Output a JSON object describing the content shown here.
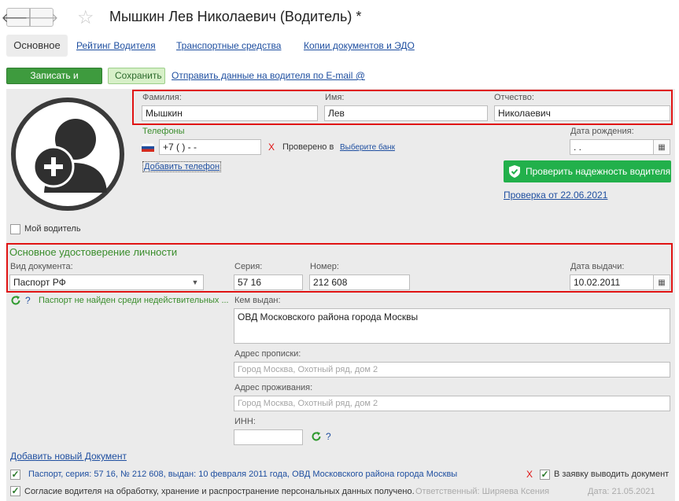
{
  "window": {
    "title": "Мышкин Лев Николаевич (Водитель) *",
    "back_icon": "arrow-left-icon",
    "forward_icon": "arrow-right-icon",
    "favorite_icon": "star-icon"
  },
  "tabs": [
    {
      "label": "Основное"
    },
    {
      "label": "Рейтинг Водителя"
    },
    {
      "label": "Транспортные средства"
    },
    {
      "label": "Копии документов и ЭДО"
    }
  ],
  "toolbar": {
    "save_close_label": "Записать и закрыть",
    "save_label": "Сохранить",
    "send_email_label": "Отправить данные на водителя по E-mail @"
  },
  "name": {
    "surname_label": "Фамилия:",
    "surname_value": "Мышкин",
    "firstname_label": "Имя:",
    "firstname_value": "Лев",
    "patronymic_label": "Отчество:",
    "patronymic_value": "Николаевич"
  },
  "phones": {
    "section_label": "Телефоны",
    "phone_value": "+7 (   )     -    -",
    "invalid_mark": "X",
    "verified_label": "Проверено в",
    "choose_bank_link": "Выберите банк",
    "add_phone_link": "Добавить телефон"
  },
  "birth": {
    "label": "Дата рождения:",
    "value": "  .  ."
  },
  "reliability": {
    "button_label": "Проверить надежность водителя",
    "check_link": "Проверка от 22.06.2021"
  },
  "my_driver": {
    "label": "Мой водитель",
    "checked": false
  },
  "identity": {
    "section_title": "Основное удостоверение личности",
    "doc_type_label": "Вид документа:",
    "doc_type_value": "Паспорт РФ",
    "series_label": "Серия:",
    "series_value": "57 16",
    "number_label": "Номер:",
    "number_value": "212 608",
    "issue_date_label": "Дата выдачи:",
    "issue_date_value": "10.02.2011",
    "invalid_check_question": "?",
    "invalid_check_text": "Паспорт не найден среди недействительных ...",
    "issued_by_label": "Кем выдан:",
    "issued_by_value": "ОВД Московского района города Москвы"
  },
  "addresses": {
    "registration_label": "Адрес прописки:",
    "registration_value": "Город Москва, Охотный ряд, дом 2",
    "residence_label": "Адрес проживания:",
    "residence_value": "Город Москва, Охотный ряд, дом 2"
  },
  "inn": {
    "label": "ИНН:",
    "value": "",
    "question": "?"
  },
  "documents": {
    "add_link": "Добавить новый Документ",
    "doc_line": "Паспорт, серия: 57 16, № 212 608, выдан: 10 февраля 2011 года, ОВД Московского района города Москвы",
    "remove_mark": "X",
    "in_request_label": "В заявку выводить документ"
  },
  "consent": {
    "text": "Согласие водителя на обработку, хранение и распространение персональных данных получено.",
    "responsible": "Ответственный: Ширяева Ксения",
    "date": "Дата: 21.05.2021"
  },
  "colors": {
    "accent_green": "#22b04b",
    "link_blue": "#1f4fa0",
    "highlight_red": "#e01313"
  }
}
